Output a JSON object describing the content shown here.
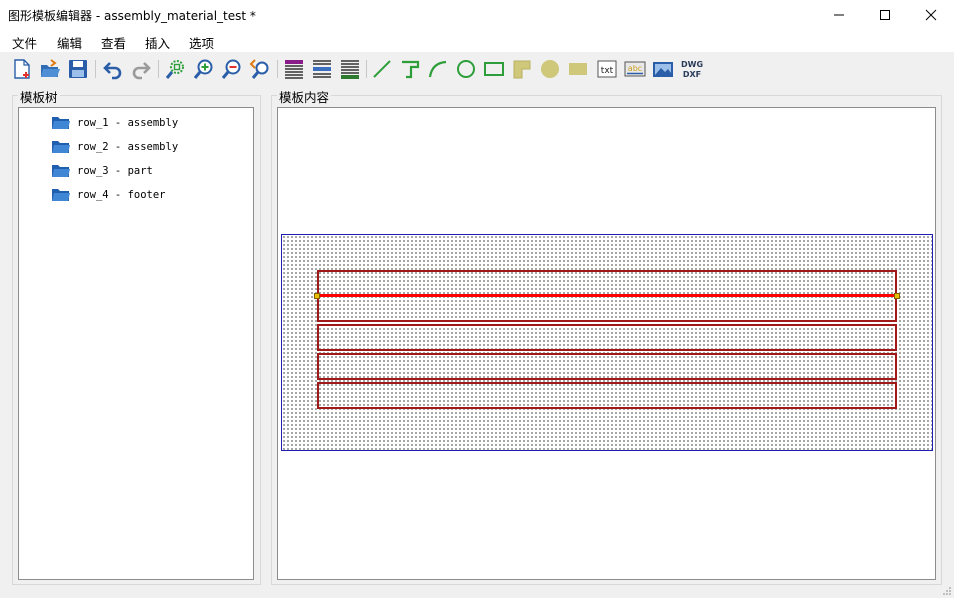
{
  "window": {
    "title": "图形模板编辑器 - assembly_material_test *"
  },
  "menu": {
    "items": [
      "文件",
      "编辑",
      "查看",
      "插入",
      "选项"
    ]
  },
  "toolbar": {
    "icons": [
      "new-file-icon",
      "open-folder-icon",
      "save-icon",
      "undo-icon",
      "redo-icon",
      "zoom-fit-icon",
      "zoom-in-icon",
      "zoom-out-icon",
      "zoom-previous-icon",
      "table-icon",
      "table-header-icon",
      "table-grid-icon",
      "line-tool-icon",
      "polyline-tool-icon",
      "arc-tool-icon",
      "circle-tool-icon",
      "rectangle-tool-icon",
      "filled-polygon-icon",
      "filled-circle-icon",
      "filled-rectangle-icon",
      "text-tool-icon",
      "label-text-icon",
      "image-tool-icon",
      "dwg-dxf-icon"
    ],
    "text_icon_label": "txt",
    "label_icon_label": "abc",
    "dwg_label": "DWG",
    "dxf_label": "DXF"
  },
  "tree_panel": {
    "title": "模板树",
    "items": [
      {
        "label": "row_1 - assembly"
      },
      {
        "label": "row_2 - assembly"
      },
      {
        "label": "row_3 - part"
      },
      {
        "label": "row_4 - footer"
      }
    ]
  },
  "content_panel": {
    "title": "模板内容"
  },
  "colors": {
    "row_border": "#a01818",
    "selection_line": "#ff0000",
    "frame_border": "#1f1fb4"
  }
}
